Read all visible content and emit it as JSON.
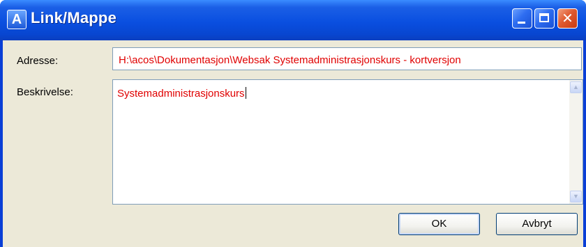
{
  "window": {
    "title": "Link/Mappe",
    "icon_letter": "A"
  },
  "titlebar_buttons": {
    "minimize_icon": "minimize-icon",
    "maximize_icon": "maximize-icon",
    "close_icon": "close-icon"
  },
  "form": {
    "address_label": "Adresse:",
    "address_value": "H:\\acos\\Dokumentasjon\\Websak Systemadministrasjonskurs - kortversjon",
    "description_label": "Beskrivelse:",
    "description_value": "Systemadministrasjonskurs"
  },
  "buttons": {
    "ok_label": "OK",
    "cancel_label": "Avbryt"
  },
  "colors": {
    "titlebar": "#0a4fe0",
    "field_text": "#e00000",
    "client_bg": "#ece9d8"
  }
}
